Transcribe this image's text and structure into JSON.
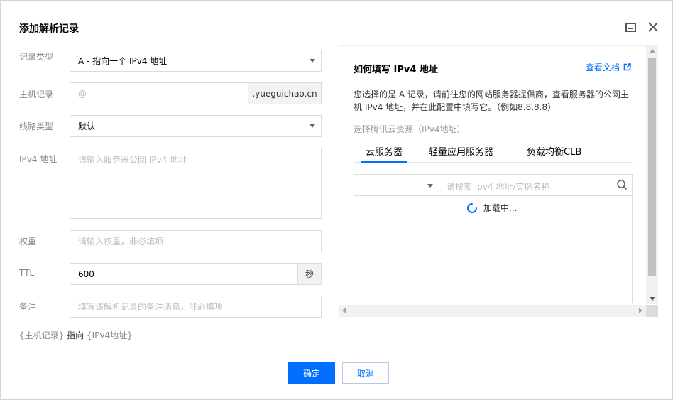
{
  "dialog": {
    "title": "添加解析记录",
    "minimize_icon": "minimize-icon",
    "close_icon": "close-icon"
  },
  "form": {
    "record_type": {
      "label": "记录类型",
      "value": "A - 指向一个 IPv4 地址"
    },
    "host_record": {
      "label": "主机记录",
      "placeholder": "@",
      "suffix": ".yueguichao.cn"
    },
    "line_type": {
      "label": "线路类型",
      "value": "默认"
    },
    "ipv4": {
      "label": "IPv4 地址",
      "placeholder": "请输入服务器公网 IPv4 地址"
    },
    "weight": {
      "label": "权重",
      "placeholder": "请输入权重，非必填项"
    },
    "ttl": {
      "label": "TTL",
      "value": "600",
      "unit": "秒"
    },
    "remark": {
      "label": "备注",
      "placeholder": "填写该解析记录的备注消息，非必填项"
    }
  },
  "summary": {
    "left": "{主机记录}",
    "middle": "指向",
    "right": "{IPv4地址}"
  },
  "buttons": {
    "ok": "确定",
    "cancel": "取消"
  },
  "help_panel": {
    "title": "如何填写 IPv4 地址",
    "doc_link": "查看文档",
    "description": "您选择的是 A 记录，请前往您的网站服务器提供商，查看服务器的公网主机 IPv4 地址，并在此配置中填写它。（例如8.8.8.8）",
    "subtitle": "选择腾讯云资源（IPv4地址）",
    "tabs": [
      "云服务器",
      "轻量应用服务器",
      "负载均衡CLB"
    ],
    "search_placeholder": "请搜索 ipv4 地址/实例名称",
    "loading_text": "加载中...",
    "accent_color": "#006eff"
  }
}
